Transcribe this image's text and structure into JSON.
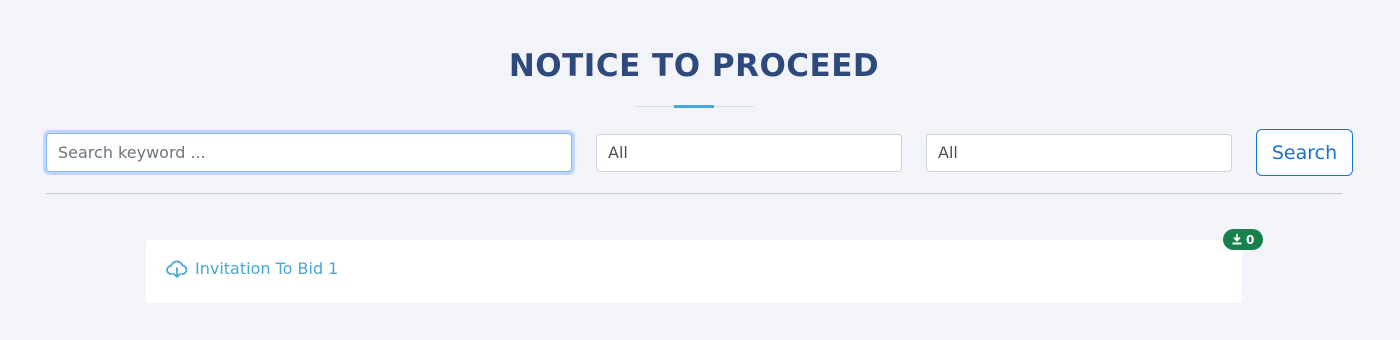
{
  "page": {
    "title": "NOTICE TO PROCEED"
  },
  "search": {
    "placeholder": "Search keyword ...",
    "value": "",
    "filter_1_value": "All",
    "filter_2_value": "All",
    "button_label": "Search"
  },
  "documents": [
    {
      "title": "Invitation To Bid 1",
      "icon": "cloud-download-icon",
      "download_count": "0"
    }
  ],
  "colors": {
    "title": "#2e4a7d",
    "accent": "#4aa8d8",
    "link": "#45a9d6",
    "button": "#1a6fd4",
    "badge": "#17804d"
  }
}
